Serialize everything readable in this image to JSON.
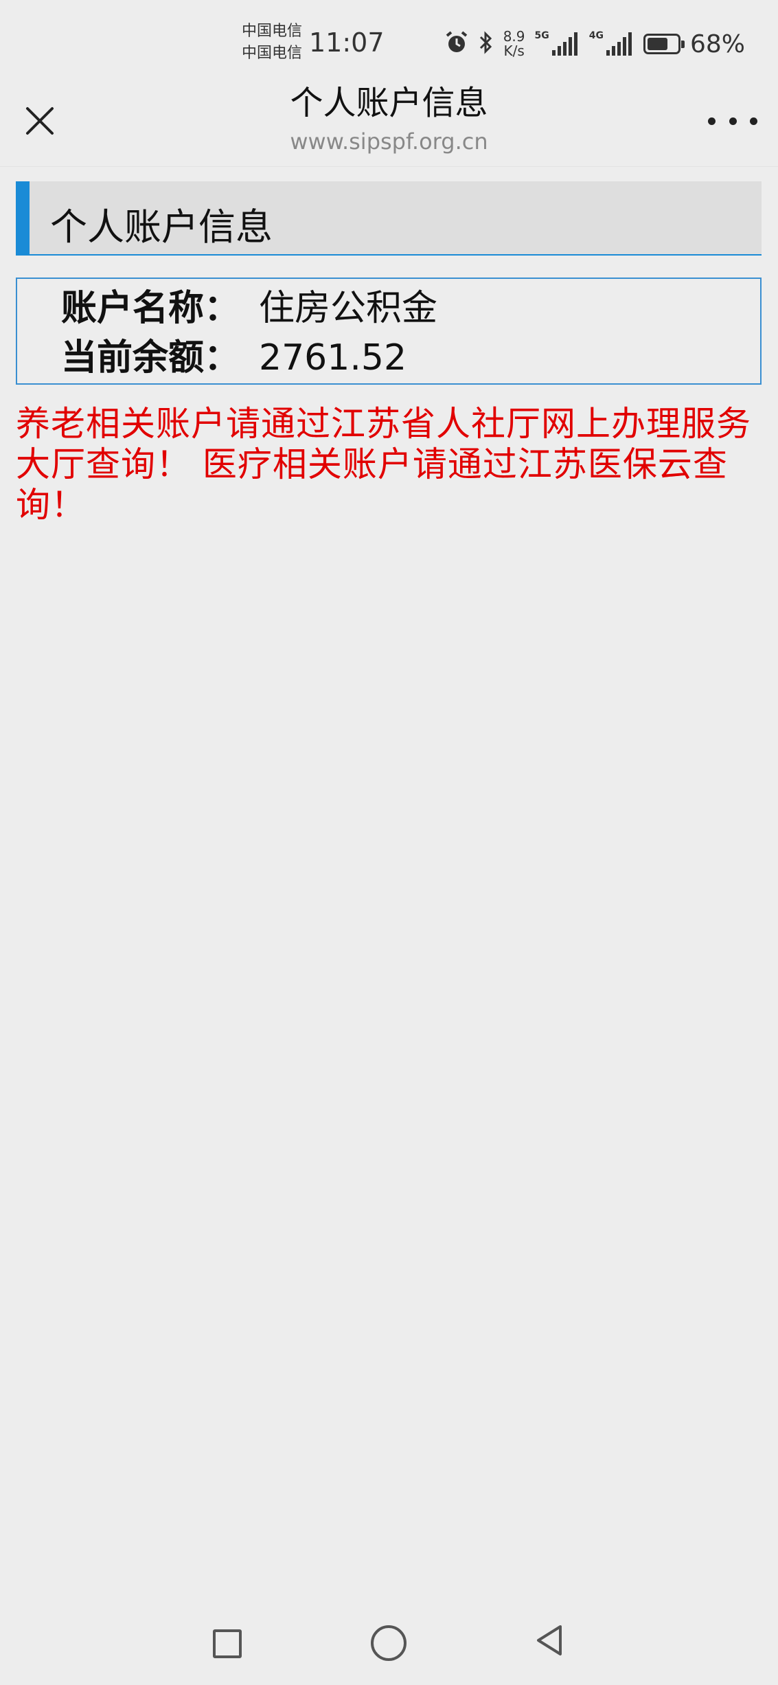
{
  "status_bar": {
    "carrier1": "中国电信",
    "carrier2": "中国电信",
    "time": "11:07",
    "speed_value": "8.9",
    "speed_unit": "K/s",
    "network1": "5G",
    "network2": "4G",
    "battery_percent": "68%",
    "battery_level": 0.68
  },
  "navbar": {
    "title": "个人账户信息",
    "url": "www.sipspf.org.cn"
  },
  "section": {
    "title": "个人账户信息"
  },
  "account": {
    "name_label": "账户名称：",
    "name_value": "住房公积金",
    "balance_label": "当前余额：",
    "balance_value": "2761.52"
  },
  "notice": "养老相关账户请通过江苏省人社厅网上办理服务大厅查询！ 医疗相关账户请通过江苏医保云查询！",
  "colors": {
    "accent": "#1a8bd6",
    "notice": "#e10000",
    "background": "#ededed"
  },
  "icons": [
    "close-icon",
    "more-icon",
    "alarm-icon",
    "bluetooth-icon",
    "signal-icon",
    "battery-icon",
    "recent-apps-icon",
    "home-icon",
    "back-icon"
  ]
}
